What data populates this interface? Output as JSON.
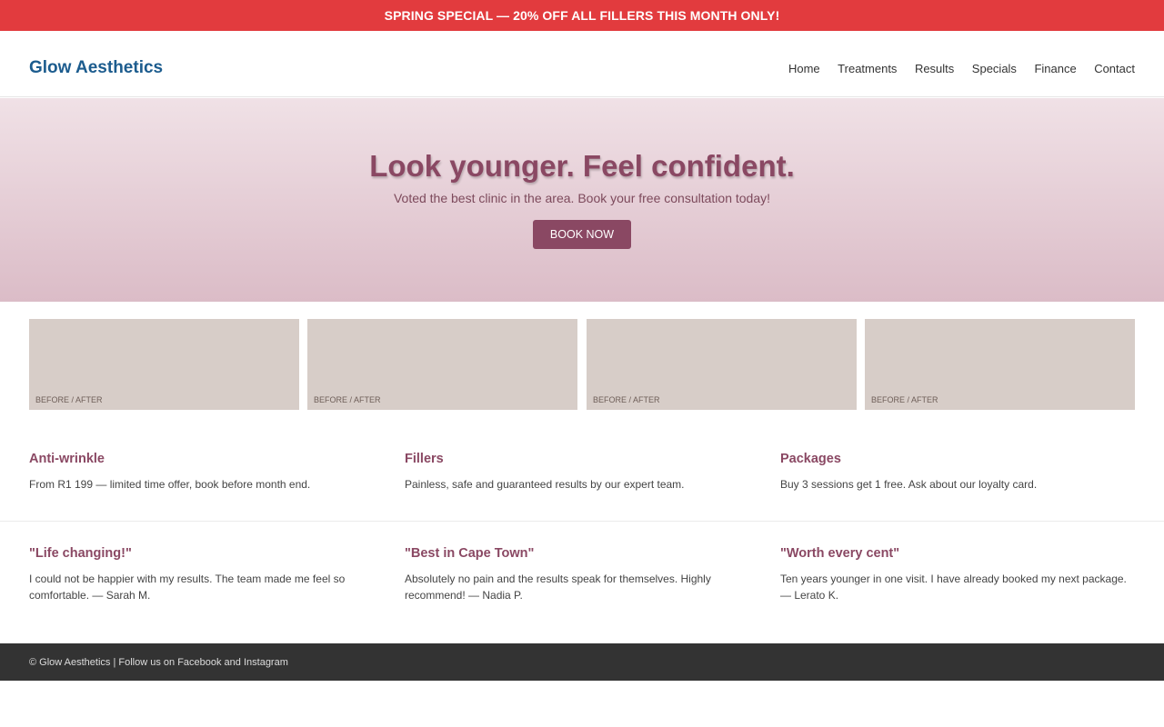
{
  "promo": {
    "text": "SPRING SPECIAL — 20% OFF ALL FILLERS THIS MONTH ONLY!"
  },
  "header": {
    "logo": "Glow Aesthetics",
    "nav": [
      "Home",
      "Treatments",
      "Results",
      "Specials",
      "Finance",
      "Contact"
    ]
  },
  "hero": {
    "title": "Look younger. Feel confident.",
    "subtitle": "Voted the best clinic in the area. Book your free consultation today!",
    "button": "BOOK NOW"
  },
  "gallery": [
    {
      "label": "BEFORE / AFTER"
    },
    {
      "label": "BEFORE / AFTER"
    },
    {
      "label": "BEFORE / AFTER"
    },
    {
      "label": "BEFORE / AFTER"
    }
  ],
  "features": [
    {
      "title": "Anti-wrinkle",
      "text": "From R1 199 — limited time offer, book before month end."
    },
    {
      "title": "Fillers",
      "text": "Painless, safe and guaranteed results by our expert team."
    },
    {
      "title": "Packages",
      "text": "Buy 3 sessions get 1 free. Ask about our loyalty card."
    }
  ],
  "testimonials": [
    {
      "title": "\"Life changing!\"",
      "text": "I could not be happier with my results. The team made me feel so comfortable. — Sarah M."
    },
    {
      "title": "\"Best in Cape Town\"",
      "text": "Absolutely no pain and the results speak for themselves. Highly recommend! — Nadia P."
    },
    {
      "title": "\"Worth every cent\"",
      "text": "Ten years younger in one visit. I have already booked my next package. — Lerato K."
    }
  ],
  "footer": {
    "text": "© Glow Aesthetics | Follow us on Facebook and Instagram"
  },
  "colors": {
    "promo": "#e23b3e",
    "brand": "#1c5c8e",
    "accent": "#8a4863",
    "footer": "#333333"
  }
}
